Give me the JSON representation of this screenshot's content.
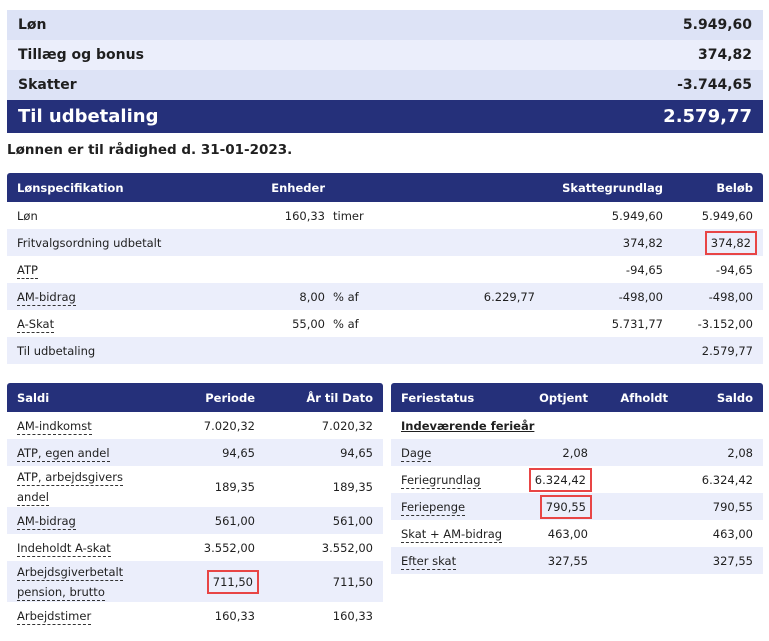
{
  "summary": {
    "rows": [
      {
        "label": "Løn",
        "value": "5.949,60"
      },
      {
        "label": "Tillæg og bonus",
        "value": "374,82"
      },
      {
        "label": "Skatter",
        "value": "-3.744,65"
      }
    ],
    "total": {
      "label": "Til udbetaling",
      "value": "2.579,77"
    }
  },
  "available_text": "Lønnen er til rådighed d. 31-01-2023.",
  "spec": {
    "headers": [
      "Lønspecifikation",
      "Enheder",
      "",
      "",
      "Skattegrundlag",
      "Beløb"
    ],
    "rows": [
      {
        "name": "Løn",
        "units": "160,33",
        "unit": "timer",
        "base": "",
        "tax": "5.949,60",
        "amount": "5.949,60"
      },
      {
        "name": "Fritvalgsordning udbetalt",
        "units": "",
        "unit": "",
        "base": "",
        "tax": "374,82",
        "amount": "374,82"
      },
      {
        "name": "ATP",
        "units": "",
        "unit": "",
        "base": "",
        "tax": "-94,65",
        "amount": "-94,65"
      },
      {
        "name": "AM-bidrag",
        "units": "8,00",
        "unit": "% af",
        "base": "6.229,77",
        "tax": "-498,00",
        "amount": "-498,00"
      },
      {
        "name": "A-Skat",
        "units": "55,00",
        "unit": "% af",
        "base": "",
        "tax": "5.731,77",
        "amount": "-3.152,00"
      },
      {
        "name": "Til udbetaling",
        "units": "",
        "unit": "",
        "base": "",
        "tax": "",
        "amount": "2.579,77"
      }
    ]
  },
  "saldi": {
    "headers": [
      "Saldi",
      "Periode",
      "År til Dato"
    ],
    "rows": [
      {
        "name": "AM-indkomst",
        "period": "7.020,32",
        "ytd": "7.020,32"
      },
      {
        "name": "ATP, egen andel",
        "period": "94,65",
        "ytd": "94,65"
      },
      {
        "name": "ATP, arbejdsgivers andel",
        "period": "189,35",
        "ytd": "189,35"
      },
      {
        "name": "AM-bidrag",
        "period": "561,00",
        "ytd": "561,00"
      },
      {
        "name": "Indeholdt A-skat",
        "period": "3.552,00",
        "ytd": "3.552,00"
      },
      {
        "name": "Arbejdsgiverbetalt pension, brutto",
        "period": "711,50",
        "ytd": "711,50"
      },
      {
        "name": "Arbejdstimer",
        "period": "160,33",
        "ytd": "160,33"
      }
    ]
  },
  "ferie": {
    "headers": [
      "Feriestatus",
      "Optjent",
      "Afholdt",
      "Saldo"
    ],
    "section": "Indeværende ferieår",
    "rows": [
      {
        "name": "Dage",
        "earned": "2,08",
        "taken": "",
        "balance": "2,08"
      },
      {
        "name": "Feriegrundlag",
        "earned": "6.324,42",
        "taken": "",
        "balance": "6.324,42"
      },
      {
        "name": "Feriepenge",
        "earned": "790,55",
        "taken": "",
        "balance": "790,55"
      },
      {
        "name": "Skat + AM-bidrag",
        "earned": "463,00",
        "taken": "",
        "balance": "463,00"
      },
      {
        "name": "Efter skat",
        "earned": "327,55",
        "taken": "",
        "balance": "327,55"
      }
    ]
  },
  "colors": {
    "header": "#25307a",
    "band": "#dde3f6",
    "band_alt": "#ebeefb",
    "highlight": "#e84545"
  }
}
